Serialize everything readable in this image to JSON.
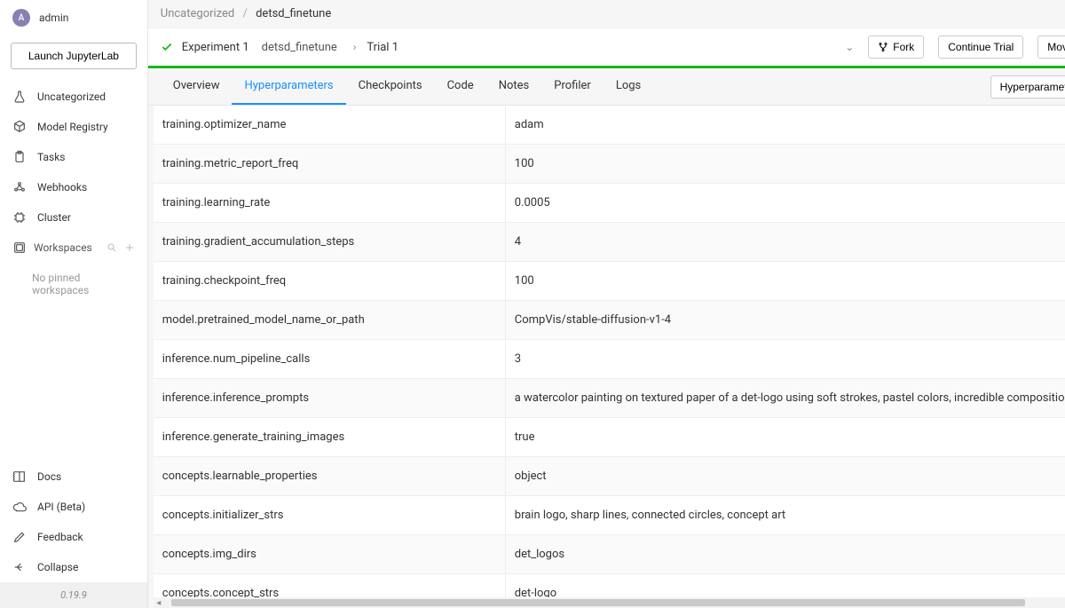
{
  "user": {
    "avatar_letter": "A",
    "name": "admin"
  },
  "launch_label": "Launch JupyterLab",
  "nav": {
    "uncategorized": "Uncategorized",
    "model_registry": "Model Registry",
    "tasks": "Tasks",
    "webhooks": "Webhooks",
    "cluster": "Cluster",
    "workspaces": "Workspaces",
    "no_pinned": "No pinned workspaces",
    "docs": "Docs",
    "api": "API (Beta)",
    "feedback": "Feedback",
    "collapse": "Collapse"
  },
  "version": "0.19.9",
  "breadcrumb": {
    "parent": "Uncategorized",
    "current": "detsd_finetune"
  },
  "experiment": {
    "exp_label": "Experiment 1",
    "exp_title": "detsd_finetune",
    "trial": "Trial 1",
    "fork": "Fork",
    "continue": "Continue Trial",
    "move": "Move"
  },
  "tabs": {
    "overview": "Overview",
    "hyperparameters": "Hyperparameters",
    "checkpoints": "Checkpoints",
    "code": "Code",
    "notes": "Notes",
    "profiler": "Profiler",
    "logs": "Logs"
  },
  "search_btn": "Hyperparameter Search",
  "rows": [
    {
      "k": "training.optimizer_name",
      "v": "adam"
    },
    {
      "k": "training.metric_report_freq",
      "v": "100"
    },
    {
      "k": "training.learning_rate",
      "v": "0.0005"
    },
    {
      "k": "training.gradient_accumulation_steps",
      "v": "4"
    },
    {
      "k": "training.checkpoint_freq",
      "v": "100"
    },
    {
      "k": "model.pretrained_model_name_or_path",
      "v": "CompVis/stable-diffusion-v1-4"
    },
    {
      "k": "inference.num_pipeline_calls",
      "v": "3"
    },
    {
      "k": "inference.inference_prompts",
      "v": "a watercolor painting on textured paper of a det-logo using soft strokes, pastel colors, incredible composition, masterpi"
    },
    {
      "k": "inference.generate_training_images",
      "v": "true"
    },
    {
      "k": "concepts.learnable_properties",
      "v": "object"
    },
    {
      "k": "concepts.initializer_strs",
      "v": "brain logo, sharp lines, connected circles, concept art"
    },
    {
      "k": "concepts.img_dirs",
      "v": "det_logos"
    },
    {
      "k": "concepts.concept_strs",
      "v": "det-logo"
    }
  ]
}
